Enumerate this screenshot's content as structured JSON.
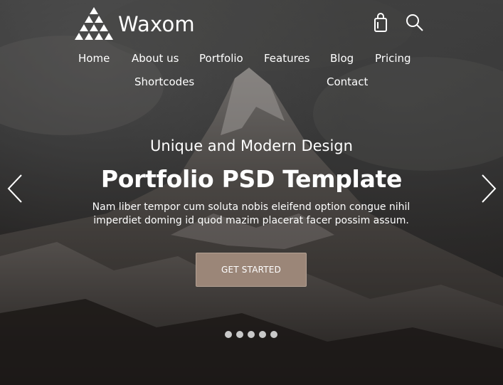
{
  "brand": {
    "name": "Waxom",
    "logo_icon": "triangle-logo-icon"
  },
  "header": {
    "icons": [
      "shopping-bag-icon",
      "search-icon"
    ]
  },
  "nav": {
    "items": [
      {
        "label": "Home"
      },
      {
        "label": "About us"
      },
      {
        "label": "Portfolio"
      },
      {
        "label": "Features"
      },
      {
        "label": "Blog"
      },
      {
        "label": "Pricing"
      },
      {
        "label": "Shortcodes"
      },
      {
        "label": "Contact"
      }
    ]
  },
  "hero": {
    "kicker": "Unique and Modern Design",
    "title": "Portfolio PSD Template",
    "description_line1": "Nam liber tempor cum soluta nobis eleifend option congue nihil",
    "description_line2": "imperdiet doming id quod mazim placerat facer possim assum.",
    "cta_label": "GET STARTED",
    "slide_count": 5
  },
  "colors": {
    "accent": "#9b8678",
    "text": "#ffffff",
    "dot": "#c9c9c9"
  }
}
